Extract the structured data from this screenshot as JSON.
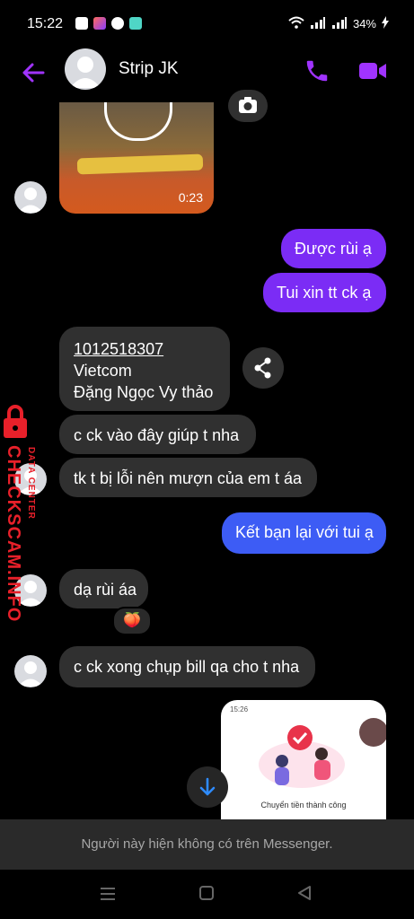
{
  "status_bar": {
    "time": "15:22",
    "battery": "34%"
  },
  "header": {
    "contact_name": "Strip JK"
  },
  "messages": {
    "video_duration": "0:23",
    "out1": "Được rùi ạ",
    "out2": "Tui xin tt ck ạ",
    "bank_account": "1012518307",
    "bank_name": "Vietcom",
    "account_holder": "Đặng Ngọc Vy thảo",
    "in2": "c ck vào đây giúp t nha",
    "in3": "tk t bị lỗi nên mượn của em t áa",
    "out3": "Kết bạn lại với tui ạ",
    "in4": "dạ rùi áa",
    "reaction": "🍑",
    "in5": "c ck xong chụp bill qa cho t nha",
    "receipt_time": "15:26",
    "receipt_label": "Chuyển tiền thành công"
  },
  "watermark": {
    "line1": "DATA CENTER",
    "line2": "CHECKSCAM.INFO"
  },
  "footer": {
    "notice": "Người này hiện không có trên Messenger."
  },
  "colors": {
    "accent": "#a033ff",
    "outgoing": "#7b2cf5",
    "outgoing_blue": "#3d5cf5",
    "incoming": "#303030"
  }
}
